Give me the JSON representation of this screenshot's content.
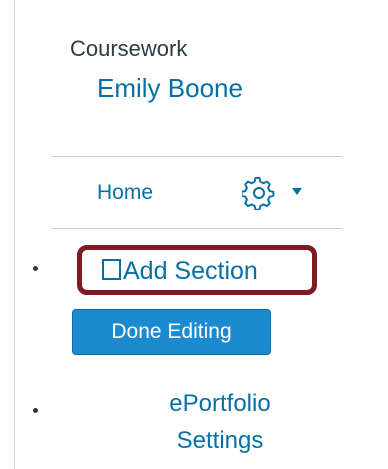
{
  "portfolio": {
    "label": "Coursework",
    "user_name": "Emily Boone"
  },
  "nav": {
    "home_label": "Home",
    "settings_icon": "gear-icon",
    "caret_icon": "caret-down-icon"
  },
  "sections": {
    "add_section_label": "Add Section",
    "add_section_icon": "checkbox-square-icon",
    "highlight_color": "#7d1a24"
  },
  "actions": {
    "done_editing_label": "Done Editing"
  },
  "footer": {
    "settings_line1": "ePortfolio",
    "settings_line2": "Settings"
  },
  "colors": {
    "link": "#0770a3",
    "button": "#1b8ace",
    "text": "#2d3b45"
  }
}
